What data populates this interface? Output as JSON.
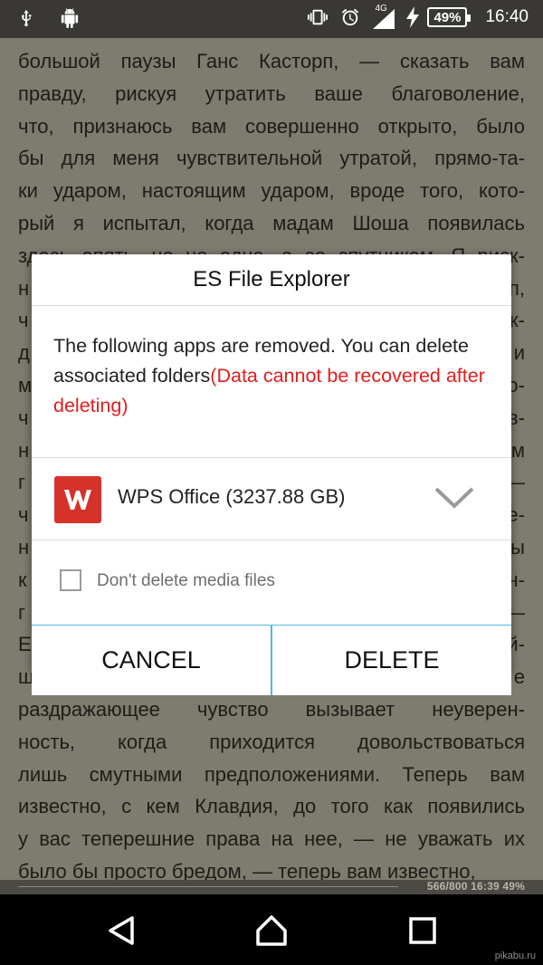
{
  "status_bar": {
    "network": "4G",
    "battery": "49%",
    "time": "16:40",
    "icons": [
      "usb-icon",
      "android-debug-icon",
      "vibrate-icon",
      "alarm-icon",
      "signal-icon",
      "charging-icon"
    ]
  },
  "reader": {
    "lines": [
      "большой паузы Ганс Касторп, — сказать вам",
      "правду, рискуя утратить ваше благоволение,",
      "что, признаюсь вам совершенно открыто, было",
      "бы для меня чувствительной утратой, прямо-та-",
      "ки ударом, настоящим ударом, вроде того, кото-",
      "рый я испытал, когда мадам Шоша появилась",
      "здесь опять, но не одна, а со спутником. Я риск-",
      "н                                                         п,",
      "ч                                                         к-",
      "д                                                         и",
      "м                                                         о-",
      "ч                                                         в-",
      "н                                                         м",
      "г                                                         —",
      "ч                                                         е-",
      "н                                                         ы",
      "к                                                         н-",
      "г                                                         —",
      "Е                                                         й-",
      "щ                                                         е",
      "раздражающее чувство вызывает неуверен-",
      "ность, когда приходится довольствоваться",
      "лишь смутными предположениями. Теперь вам",
      "известно, с кем Клавдия, до того как появились",
      "у вас теперешние права на нее, — не уважать их",
      "было бы просто бредом, — теперь вам известно,"
    ],
    "footer_info": "566/800  16:39  49%"
  },
  "dialog": {
    "title": "ES File Explorer",
    "message": "The following apps are removed. You can delete associated folders",
    "warning": "(Data cannot be recovered after deleting)",
    "app": {
      "name": "WPS Office (3237.88 GB)",
      "icon": "wps-office-icon",
      "icon_color": "#d5322b"
    },
    "checkbox_label": "Don't delete media files",
    "checkbox_checked": false,
    "cancel_label": "CANCEL",
    "delete_label": "DELETE",
    "accent_color": "#4fb9e3"
  },
  "watermark": "pikabu.ru"
}
